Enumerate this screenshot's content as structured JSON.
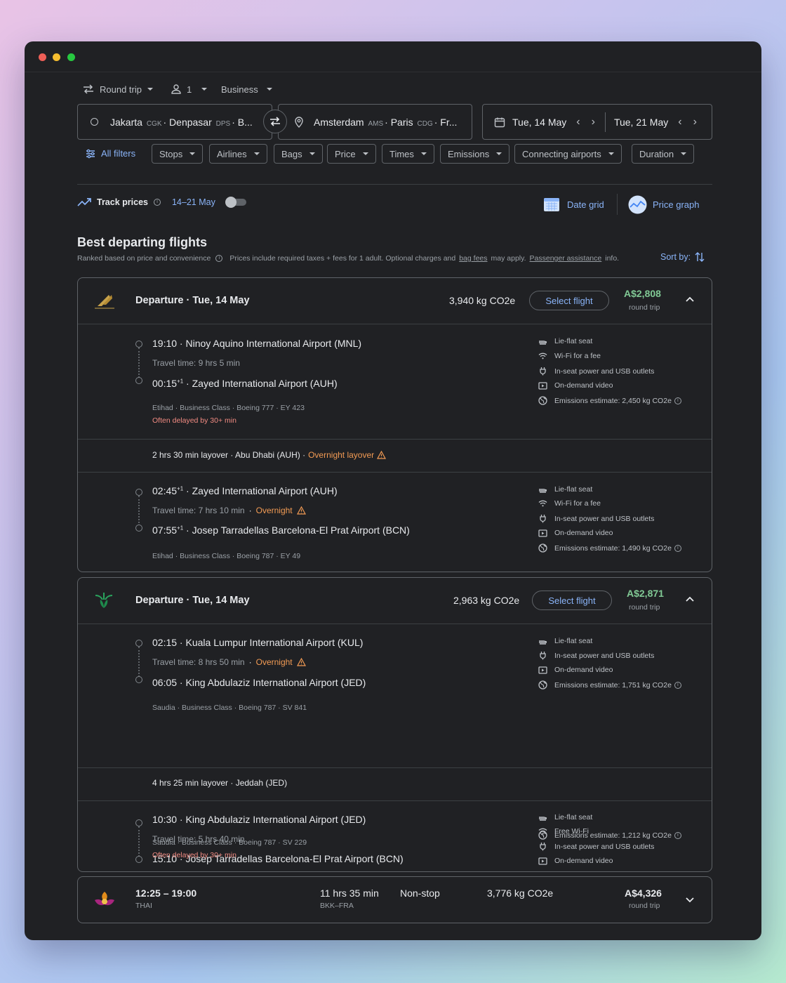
{
  "search": {
    "trip_type": "Round trip",
    "passengers": "1",
    "cabin": "Business",
    "origin": {
      "city1": "Jakarta",
      "code1": "CGK",
      "city2": "Denpasar",
      "code2": "DPS",
      "more": "B..."
    },
    "destination": {
      "city1": "Amsterdam",
      "code1": "AMS",
      "city2": "Paris",
      "code2": "CDG",
      "more": "Fr..."
    },
    "depart_date": "Tue, 14 May",
    "return_date": "Tue, 21 May"
  },
  "filters": {
    "all_filters": "All filters",
    "chips": [
      "Stops",
      "Airlines",
      "Bags",
      "Price",
      "Times",
      "Emissions",
      "Connecting airports",
      "Duration"
    ]
  },
  "track": {
    "label": "Track prices",
    "range": "14–21 May",
    "date_grid": "Date grid",
    "price_graph": "Price graph"
  },
  "section": {
    "title": "Best departing flights",
    "ranked": "Ranked based on price and convenience",
    "prices_pre": "Prices include required taxes + fees for 1 adult. Optional charges and",
    "bag_fees": "bag fees",
    "may_apply": "may apply.",
    "assistance": "Passenger assistance",
    "info": "info.",
    "sort": "Sort by:"
  },
  "colors": {
    "accent": "#8ab4f8",
    "price_green": "#81c995",
    "warning": "#f28b82",
    "background": "#202124"
  },
  "flights": [
    {
      "departure_label": "Departure",
      "date": "Tue, 14 May",
      "emissions": "3,940 kg CO2e",
      "select": "Select flight",
      "price": "A$2,808",
      "price_note": "round trip",
      "airline_logo": "etihad-logo",
      "legs": [
        {
          "dep_time": "19:10",
          "dep_sup": "",
          "dep_airport": "Ninoy Aquino International Airport (MNL)",
          "travel": "Travel time: 9 hrs 5 min",
          "travel_warn": "",
          "arr_time": "00:15",
          "arr_sup": "+1",
          "arr_airport": "Zayed International Airport (AUH)",
          "details": "Etihad · Business Class · Boeing 777 · EY 423",
          "delay": "Often delayed by 30+ min",
          "amenities": [
            {
              "icon": "seat-icon",
              "text": "Lie-flat seat"
            },
            {
              "icon": "wifi-icon",
              "text": "Wi-Fi for a fee"
            },
            {
              "icon": "power-icon",
              "text": "In-seat power and USB outlets"
            },
            {
              "icon": "video-icon",
              "text": "On-demand video"
            },
            {
              "icon": "globe-icon",
              "text": "Emissions estimate: 2,450 kg CO2e"
            }
          ]
        },
        {
          "dep_time": "02:45",
          "dep_sup": "+1",
          "dep_airport": "Zayed International Airport (AUH)",
          "travel": "Travel time: 7 hrs 10 min",
          "travel_warn": "Overnight",
          "arr_time": "07:55",
          "arr_sup": "+1",
          "arr_airport": "Josep Tarradellas Barcelona-El Prat Airport (BCN)",
          "details": "Etihad · Business Class · Boeing 787 · EY 49",
          "delay": "",
          "amenities": [
            {
              "icon": "seat-icon",
              "text": "Lie-flat seat"
            },
            {
              "icon": "wifi-icon",
              "text": "Wi-Fi for a fee"
            },
            {
              "icon": "power-icon",
              "text": "In-seat power and USB outlets"
            },
            {
              "icon": "video-icon",
              "text": "On-demand video"
            },
            {
              "icon": "globe-icon",
              "text": "Emissions estimate: 1,490 kg CO2e"
            }
          ]
        }
      ],
      "layover": {
        "text": "2 hrs 30 min layover · Abu Dhabi (AUH) ·",
        "warn": "Overnight layover"
      }
    },
    {
      "departure_label": "Departure",
      "date": "Tue, 14 May",
      "emissions": "2,963 kg CO2e",
      "select": "Select flight",
      "price": "A$2,871",
      "price_note": "round trip",
      "airline_logo": "saudia-logo",
      "legs": [
        {
          "dep_time": "02:15",
          "dep_sup": "",
          "dep_airport": "Kuala Lumpur International Airport (KUL)",
          "travel": "Travel time: 8 hrs 50 min",
          "travel_warn": "Overnight",
          "arr_time": "06:05",
          "arr_sup": "",
          "arr_airport": "King Abdulaziz International Airport (JED)",
          "details": "Saudia · Business Class · Boeing 787 · SV 841",
          "delay": "",
          "amenities": [
            {
              "icon": "seat-icon",
              "text": "Lie-flat seat"
            },
            {
              "icon": "power-icon",
              "text": "In-seat power and USB outlets"
            },
            {
              "icon": "video-icon",
              "text": "On-demand video"
            },
            {
              "icon": "globe-icon",
              "text": "Emissions estimate: 1,751 kg CO2e"
            }
          ]
        },
        {
          "dep_time": "10:30",
          "dep_sup": "",
          "dep_airport": "King Abdulaziz International Airport (JED)",
          "travel": "Travel time: 5 hrs 40 min",
          "travel_warn": "",
          "arr_time": "15:10",
          "arr_sup": "",
          "arr_airport": "Josep Tarradellas Barcelona-El Prat Airport (BCN)",
          "details": "Saudia · Business Class · Boeing 787 · SV 229",
          "delay": "Often delayed by 30+ min",
          "amenities": [
            {
              "icon": "seat-icon",
              "text": "Lie-flat seat"
            },
            {
              "icon": "wifi-icon",
              "text": "Free Wi-Fi"
            },
            {
              "icon": "power-icon",
              "text": "In-seat power and USB outlets"
            },
            {
              "icon": "video-icon",
              "text": "On-demand video"
            },
            {
              "icon": "globe-icon",
              "text": "Emissions estimate: 1,212 kg CO2e"
            }
          ]
        }
      ],
      "layover": {
        "text": "4 hrs 25 min layover · Jeddah (JED)",
        "warn": ""
      }
    },
    {
      "times": "12:25 – 19:00",
      "airline": "THAI",
      "duration": "11 hrs 35 min",
      "route": "BKK–FRA",
      "stops": "Non-stop",
      "emissions": "3,776 kg CO2e",
      "price": "A$4,326",
      "price_note": "round trip",
      "airline_logo": "thai-logo"
    }
  ]
}
